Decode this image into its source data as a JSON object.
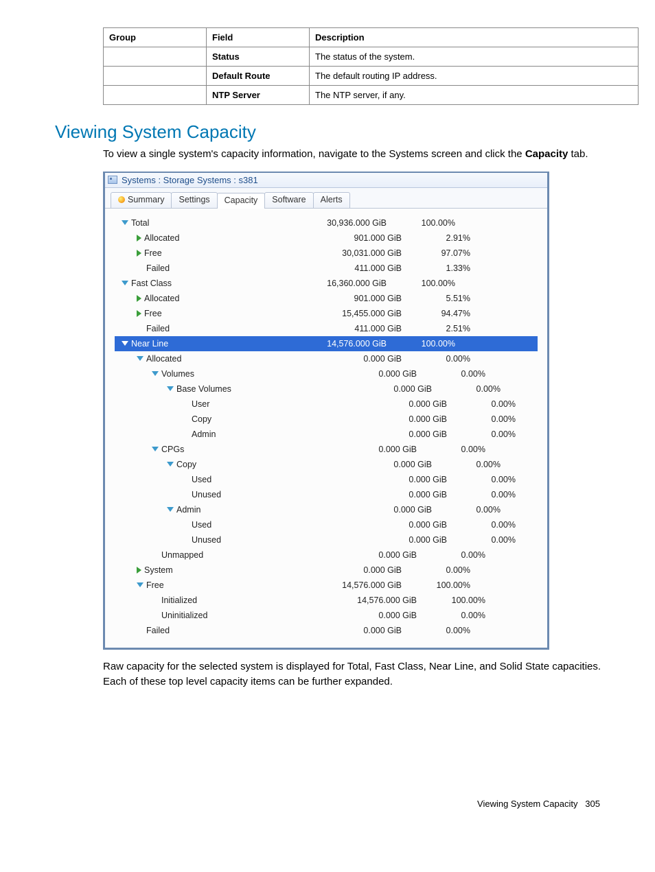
{
  "table": {
    "headers": [
      "Group",
      "Field",
      "Description"
    ],
    "rows": [
      {
        "group": "",
        "field": "Status",
        "desc": "The status of the system."
      },
      {
        "group": "",
        "field": "Default Route",
        "desc": "The default routing IP address."
      },
      {
        "group": "",
        "field": "NTP Server",
        "desc": "The NTP server, if any."
      }
    ]
  },
  "heading": "Viewing System Capacity",
  "intro_pre": "To view a single system's capacity information, navigate to the Systems screen and click the ",
  "intro_bold": "Capacity",
  "intro_post": " tab.",
  "window": {
    "title": "Systems : Storage Systems : s381",
    "tabs": [
      "Summary",
      "Settings",
      "Capacity",
      "Software",
      "Alerts"
    ],
    "active_tab": 2,
    "rows": [
      {
        "indent": 0,
        "icon": "down",
        "label": "Total",
        "val": "30,936.000 GiB",
        "pct": "100.00%",
        "sel": false
      },
      {
        "indent": 1,
        "icon": "right",
        "label": "Allocated",
        "val": "901.000 GiB",
        "pct": "2.91%"
      },
      {
        "indent": 1,
        "icon": "right",
        "label": "Free",
        "val": "30,031.000 GiB",
        "pct": "97.07%"
      },
      {
        "indent": 1,
        "icon": "none",
        "label": "Failed",
        "val": "411.000 GiB",
        "pct": "1.33%"
      },
      {
        "indent": 0,
        "icon": "down",
        "label": "Fast Class",
        "val": "16,360.000 GiB",
        "pct": "100.00%"
      },
      {
        "indent": 1,
        "icon": "right",
        "label": "Allocated",
        "val": "901.000 GiB",
        "pct": "5.51%"
      },
      {
        "indent": 1,
        "icon": "right",
        "label": "Free",
        "val": "15,455.000 GiB",
        "pct": "94.47%"
      },
      {
        "indent": 1,
        "icon": "none",
        "label": "Failed",
        "val": "411.000 GiB",
        "pct": "2.51%"
      },
      {
        "indent": 0,
        "icon": "down",
        "label": "Near Line",
        "val": "14,576.000 GiB",
        "pct": "100.00%",
        "sel": true
      },
      {
        "indent": 1,
        "icon": "down",
        "label": "Allocated",
        "val": "0.000 GiB",
        "pct": "0.00%"
      },
      {
        "indent": 2,
        "icon": "down",
        "label": "Volumes",
        "val": "0.000 GiB",
        "pct": "0.00%"
      },
      {
        "indent": 3,
        "icon": "down",
        "label": "Base Volumes",
        "val": "0.000 GiB",
        "pct": "0.00%"
      },
      {
        "indent": 4,
        "icon": "none",
        "label": "User",
        "val": "0.000 GiB",
        "pct": "0.00%"
      },
      {
        "indent": 4,
        "icon": "none",
        "label": "Copy",
        "val": "0.000 GiB",
        "pct": "0.00%"
      },
      {
        "indent": 4,
        "icon": "none",
        "label": "Admin",
        "val": "0.000 GiB",
        "pct": "0.00%"
      },
      {
        "indent": 2,
        "icon": "down",
        "label": "CPGs",
        "val": "0.000 GiB",
        "pct": "0.00%"
      },
      {
        "indent": 3,
        "icon": "down",
        "label": "Copy",
        "val": "0.000 GiB",
        "pct": "0.00%"
      },
      {
        "indent": 4,
        "icon": "none",
        "label": "Used",
        "val": "0.000 GiB",
        "pct": "0.00%"
      },
      {
        "indent": 4,
        "icon": "none",
        "label": "Unused",
        "val": "0.000 GiB",
        "pct": "0.00%"
      },
      {
        "indent": 3,
        "icon": "down",
        "label": "Admin",
        "val": "0.000 GiB",
        "pct": "0.00%"
      },
      {
        "indent": 4,
        "icon": "none",
        "label": "Used",
        "val": "0.000 GiB",
        "pct": "0.00%"
      },
      {
        "indent": 4,
        "icon": "none",
        "label": "Unused",
        "val": "0.000 GiB",
        "pct": "0.00%"
      },
      {
        "indent": 2,
        "icon": "none",
        "label": "Unmapped",
        "val": "0.000 GiB",
        "pct": "0.00%"
      },
      {
        "indent": 1,
        "icon": "right",
        "label": "System",
        "val": "0.000 GiB",
        "pct": "0.00%"
      },
      {
        "indent": 1,
        "icon": "down",
        "label": "Free",
        "val": "14,576.000 GiB",
        "pct": "100.00%"
      },
      {
        "indent": 2,
        "icon": "none",
        "label": "Initialized",
        "val": "14,576.000 GiB",
        "pct": "100.00%"
      },
      {
        "indent": 2,
        "icon": "none",
        "label": "Uninitialized",
        "val": "0.000 GiB",
        "pct": "0.00%"
      },
      {
        "indent": 1,
        "icon": "none",
        "label": "Failed",
        "val": "0.000 GiB",
        "pct": "0.00%"
      }
    ]
  },
  "after": "Raw capacity for the selected system is displayed for Total, Fast Class, Near Line, and Solid State capacities. Each of these top level capacity items can be further expanded.",
  "footer_label": "Viewing System Capacity",
  "footer_page": "305"
}
